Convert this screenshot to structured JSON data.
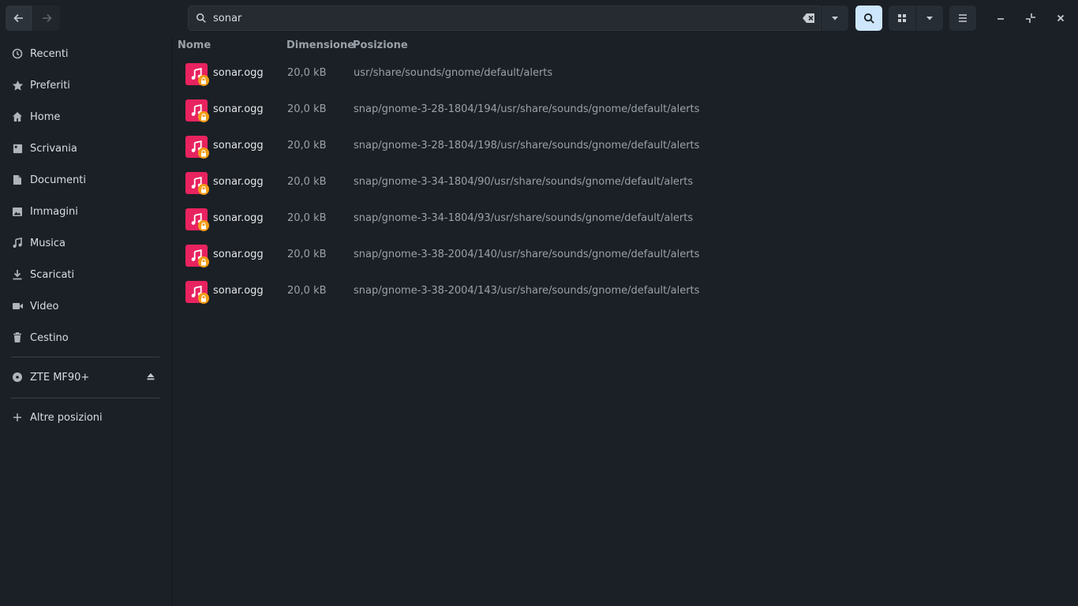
{
  "search": {
    "value": "sonar"
  },
  "sidebar": {
    "items": [
      {
        "label": "Recenti",
        "icon": "clock-icon"
      },
      {
        "label": "Preferiti",
        "icon": "star-icon"
      },
      {
        "label": "Home",
        "icon": "home-icon"
      },
      {
        "label": "Scrivania",
        "icon": "desktop-icon"
      },
      {
        "label": "Documenti",
        "icon": "document-icon"
      },
      {
        "label": "Immagini",
        "icon": "image-icon"
      },
      {
        "label": "Musica",
        "icon": "music-icon"
      },
      {
        "label": "Scaricati",
        "icon": "download-icon"
      },
      {
        "label": "Video",
        "icon": "video-icon"
      },
      {
        "label": "Cestino",
        "icon": "trash-icon"
      }
    ],
    "device": {
      "label": "ZTE MF90+",
      "icon": "disc-icon"
    },
    "other": {
      "label": "Altre posizioni",
      "icon": "plus-icon"
    }
  },
  "columns": {
    "name": "Nome",
    "size": "Dimensione",
    "location": "Posizione"
  },
  "files": [
    {
      "name": "sonar.ogg",
      "size": "20,0 kB",
      "location": "usr/share/sounds/gnome/default/alerts"
    },
    {
      "name": "sonar.ogg",
      "size": "20,0 kB",
      "location": "snap/gnome-3-28-1804/194/usr/share/sounds/gnome/default/alerts"
    },
    {
      "name": "sonar.ogg",
      "size": "20,0 kB",
      "location": "snap/gnome-3-28-1804/198/usr/share/sounds/gnome/default/alerts"
    },
    {
      "name": "sonar.ogg",
      "size": "20,0 kB",
      "location": "snap/gnome-3-34-1804/90/usr/share/sounds/gnome/default/alerts"
    },
    {
      "name": "sonar.ogg",
      "size": "20,0 kB",
      "location": "snap/gnome-3-34-1804/93/usr/share/sounds/gnome/default/alerts"
    },
    {
      "name": "sonar.ogg",
      "size": "20,0 kB",
      "location": "snap/gnome-3-38-2004/140/usr/share/sounds/gnome/default/alerts"
    },
    {
      "name": "sonar.ogg",
      "size": "20,0 kB",
      "location": "snap/gnome-3-38-2004/143/usr/share/sounds/gnome/default/alerts"
    }
  ],
  "colors": {
    "file_icon": "#e8235f",
    "lock_badge": "#f39c12",
    "accent": "#cde6fb"
  }
}
